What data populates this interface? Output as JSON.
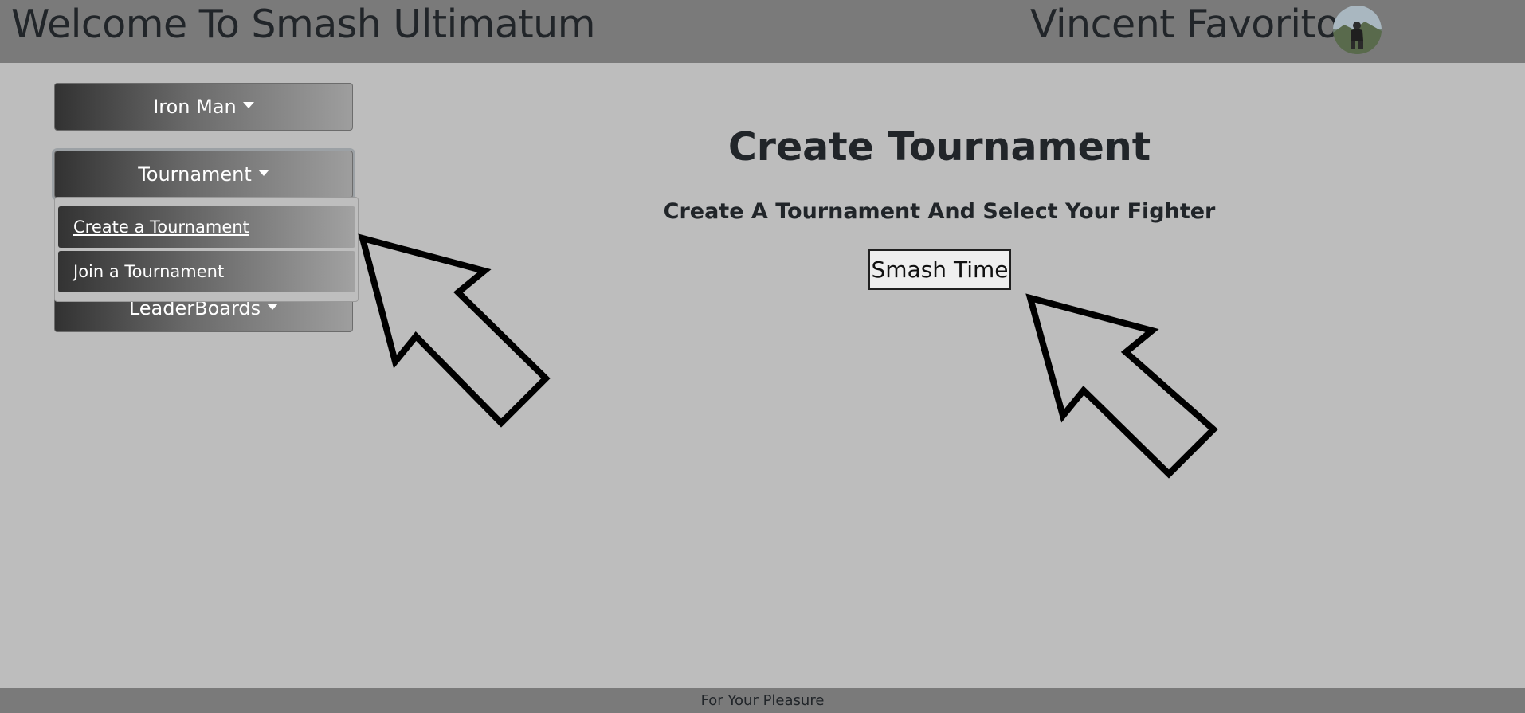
{
  "header": {
    "title": "Welcome To Smash Ultimatum",
    "user_name": "Vincent Favorito",
    "avatar_icon": "user-avatar"
  },
  "sidebar": {
    "character_dropdown": "Iron Man",
    "tournament_dropdown": "Tournament",
    "tournament_menu": [
      {
        "label": "Create a Tournament",
        "active": true
      },
      {
        "label": "Join a Tournament",
        "active": false
      }
    ],
    "leaderboards_dropdown": "LeaderBoards"
  },
  "main": {
    "title": "Create Tournament",
    "subtitle": "Create A Tournament And Select Your Fighter",
    "submit_label": "Smash Time"
  },
  "footer": {
    "text": "For Your Pleasure"
  },
  "annotations": {
    "arrow_icon": "pointer-arrow-icon",
    "arrow_count": 2
  },
  "colors": {
    "header_bg": "#7a7a7a",
    "page_bg": "#bdbdbd",
    "button_gradient_start": "#323232",
    "button_gradient_end": "#9e9e9e"
  }
}
